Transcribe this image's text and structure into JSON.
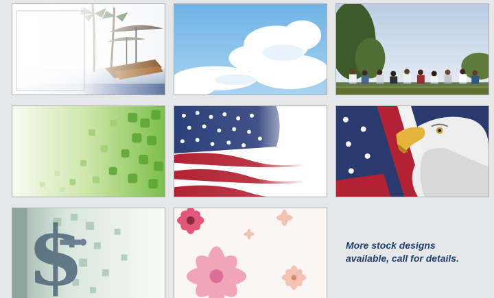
{
  "designs": [
    {
      "id": 1,
      "theme": "tropical beach with palm trees and umbrellas"
    },
    {
      "id": 2,
      "theme": "blue sky with white clouds"
    },
    {
      "id": 3,
      "theme": "group of people sitting on grass under trees"
    },
    {
      "id": 4,
      "theme": "green puzzle pieces"
    },
    {
      "id": 5,
      "theme": "waving american flag"
    },
    {
      "id": 6,
      "theme": "american flag with bald eagle"
    },
    {
      "id": 7,
      "theme": "dollar sign with mosaic tiles"
    },
    {
      "id": 8,
      "theme": "pink flowers"
    }
  ],
  "note": {
    "line1": "More stock designs",
    "line2": "available, call for details."
  },
  "colors": {
    "page_background": "#e6e7e9",
    "note_text": "#1d3f6e",
    "tile_border": "#a9abad"
  }
}
